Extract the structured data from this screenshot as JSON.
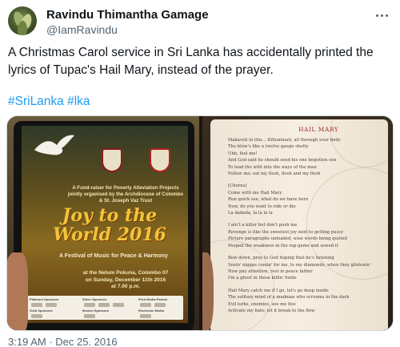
{
  "author": {
    "display_name": "Ravindu Thimantha Gamage",
    "handle": "@IamRavindu"
  },
  "tweet": {
    "text": "A Christmas Carol service in Sri Lanka has accidentally printed the lyrics of Tupac's Hail Mary, instead of the prayer.",
    "hashtags": [
      "#SriLanka",
      "#lka"
    ],
    "time": "3:19 AM",
    "date": "Dec 25. 2016"
  },
  "media": {
    "cover": {
      "fund_text": "A Fund-raiser for Poverty Alleviation Projects jointly organised by the Archdiocese of Colombo & St. Joseph Vaz Trust",
      "title": "Joy to the World 2016",
      "festival": "A Festival of Music for Peace & Harmony",
      "venue_lines": [
        "at the Nelum Pokuna, Colombo 07",
        "on Sunday, December 11th 2016",
        "at 7.00 p.m."
      ],
      "sponsor_labels": [
        "Platinum Sponsors",
        "Silver Sponsors",
        "Print Media Partner",
        "Gold Sponsors",
        "Bronze Sponsors",
        "Electronic Media"
      ]
    },
    "lyrics_page": {
      "heading": "HAIL MARY",
      "stanzas": [
        "Makaveli in this... Killuminati, all through your body\nThe blow's like a twelve gauge shotty\nUhh, feel me!\nAnd God said he should send his one begotten son\nTo lead the wild into the ways of the man\nFollow me; eat my flesh, flesh and my flesh",
        "[Chorus]\nCome with me Hail Mary\nRun quick see, what do we have here\nNow, do you want to ride or die\nLa dadada, la la la la",
        "I ain't a killer but don't push me\nRevenge is like the sweetest joy next to getting pussy\nPicture paragraphs unloaded, wise words being quoted\nPeeped the weakness in the rap game and sewed it",
        "Bow down, pray to God hoping that he's listening\nSeein' niggas comin' for me, to my diamonds, when they glistenin'\nNow pay attention, rest in peace father\nI'm a ghost in these killin' fields",
        "Hail Mary catch me if I go, let's go deep inside\nThe solitary mind of a madman who screams in the dark\nEvil lurks, enemies, see me flee\nActivate my hate; let it break to the flow"
      ]
    }
  },
  "colors": {
    "link": "#1d9bf0",
    "secondary_text": "#536471",
    "primary_text": "#0f1419"
  },
  "icons": {
    "more": "more-options-icon"
  }
}
